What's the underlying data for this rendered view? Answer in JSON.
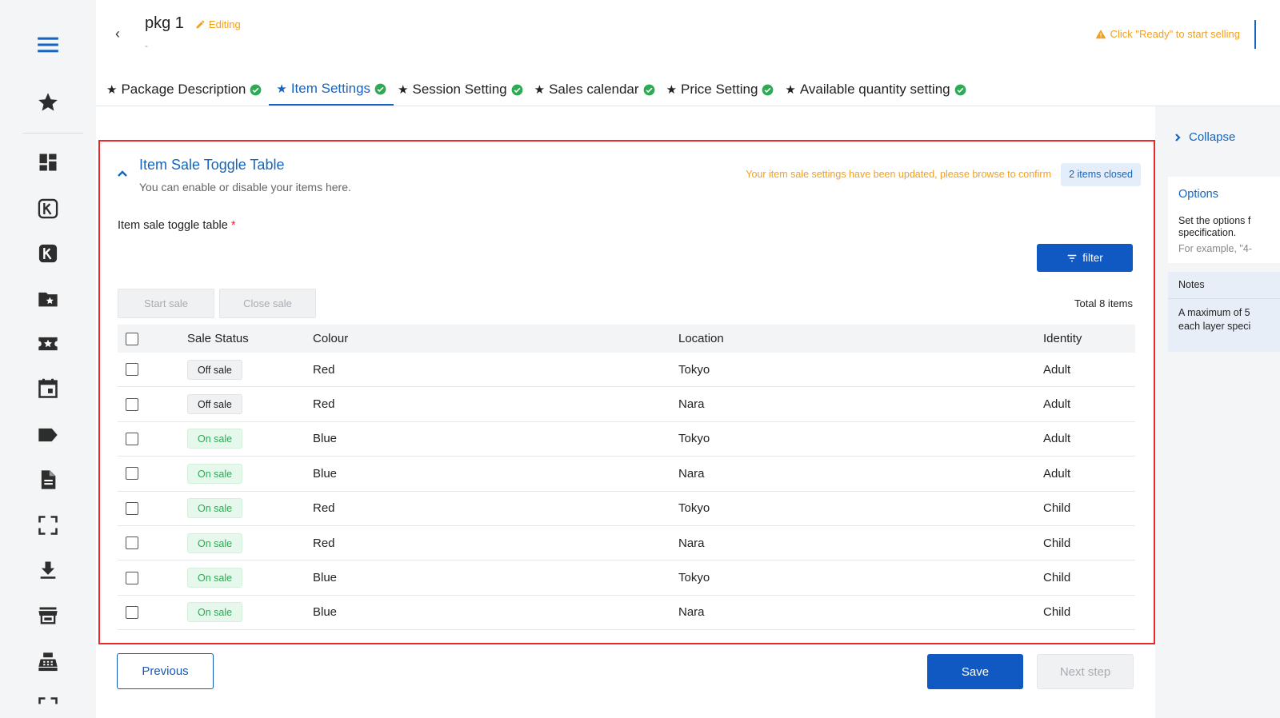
{
  "header": {
    "back_glyph": "‹",
    "package_title": "pkg 1",
    "editing_label": "Editing",
    "subtitle": "-",
    "warning": "Click \"Ready\" to start selling"
  },
  "tabs": [
    {
      "label": "Package Description",
      "active": false
    },
    {
      "label": "Item Settings",
      "active": true
    },
    {
      "label": "Session Setting",
      "active": false
    },
    {
      "label": "Sales calendar",
      "active": false
    },
    {
      "label": "Price Setting",
      "active": false
    },
    {
      "label": "Available quantity setting",
      "active": false
    }
  ],
  "sidebar": {
    "icons": [
      "menu-icon",
      "star-icon",
      "dashboard-icon",
      "k-outline-icon",
      "k-filled-icon",
      "folder-star-icon",
      "ticket-star-icon",
      "calendar-icon",
      "tag-icon",
      "document-icon",
      "fullscreen-icon",
      "download-icon",
      "store-icon",
      "cash-register-icon",
      "expand-icon"
    ]
  },
  "card": {
    "title": "Item Sale Toggle Table",
    "subtitle": "You can enable or disable your items here.",
    "update_note": "Your item sale settings have been updated, please browse to confirm",
    "closed_badge": "2 items closed",
    "field_label": "Item sale toggle table",
    "required_mark": "*",
    "filter_label": "filter",
    "start_sale_label": "Start sale",
    "close_sale_label": "Close sale",
    "total": "Total 8 items"
  },
  "table": {
    "headers": [
      "Sale Status",
      "Colour",
      "Location",
      "Identity"
    ],
    "rows": [
      {
        "status": "Off sale",
        "on": false,
        "colour": "Red",
        "location": "Tokyo",
        "identity": "Adult"
      },
      {
        "status": "Off sale",
        "on": false,
        "colour": "Red",
        "location": "Nara",
        "identity": "Adult"
      },
      {
        "status": "On sale",
        "on": true,
        "colour": "Blue",
        "location": "Tokyo",
        "identity": "Adult"
      },
      {
        "status": "On sale",
        "on": true,
        "colour": "Blue",
        "location": "Nara",
        "identity": "Adult"
      },
      {
        "status": "On sale",
        "on": true,
        "colour": "Red",
        "location": "Tokyo",
        "identity": "Child"
      },
      {
        "status": "On sale",
        "on": true,
        "colour": "Red",
        "location": "Nara",
        "identity": "Child"
      },
      {
        "status": "On sale",
        "on": true,
        "colour": "Blue",
        "location": "Tokyo",
        "identity": "Child"
      },
      {
        "status": "On sale",
        "on": true,
        "colour": "Blue",
        "location": "Nara",
        "identity": "Child"
      }
    ]
  },
  "footer": {
    "previous_label": "Previous",
    "save_label": "Save",
    "next_label": "Next step"
  },
  "right_panel": {
    "collapse_label": "Collapse",
    "options_title": "Options",
    "options_line1": "Set the options f",
    "options_line2": "specification.",
    "options_example": "For example, \"4-",
    "notes_title": "Notes",
    "notes_line1": "A maximum of 5",
    "notes_line2": "each layer speci"
  },
  "colors": {
    "primary": "#1059c2",
    "warning": "#f0a020",
    "highlight_border": "#e8282b",
    "on_sale_text": "#2eaa55",
    "check_green": "#2eaa55"
  }
}
